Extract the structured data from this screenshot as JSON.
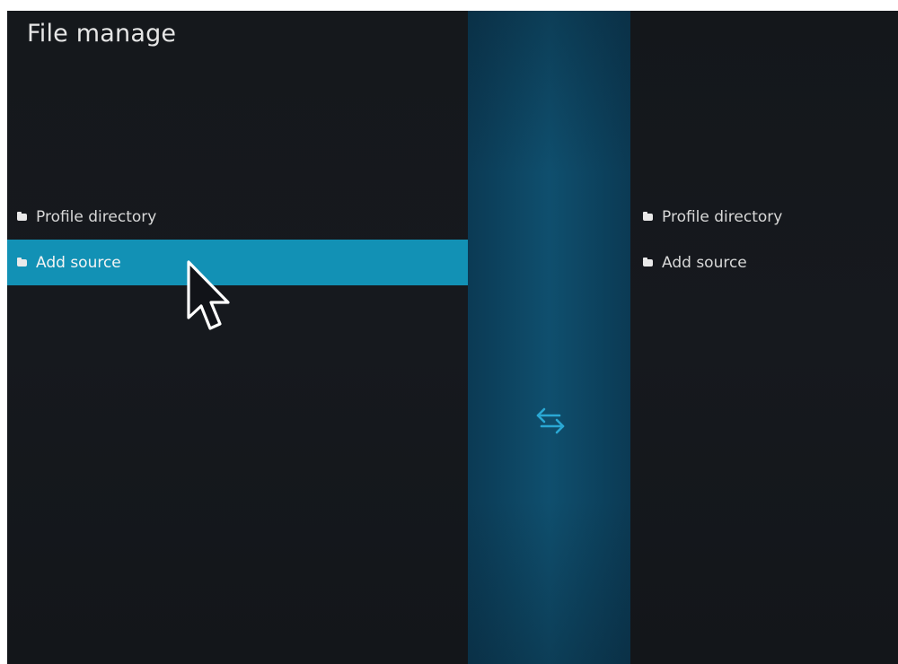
{
  "header": {
    "title": "File manage"
  },
  "left_pane": {
    "items": [
      {
        "label": "Profile directory",
        "icon": "folder-icon",
        "selected": false
      },
      {
        "label": "Add source",
        "icon": "folder-icon",
        "selected": true
      }
    ]
  },
  "right_pane": {
    "items": [
      {
        "label": "Profile directory",
        "icon": "folder-icon",
        "selected": false
      },
      {
        "label": "Add source",
        "icon": "folder-icon",
        "selected": false
      }
    ]
  },
  "divider": {
    "icon": "swap-arrows-icon"
  },
  "colors": {
    "background": "#15181d",
    "selection": "#1291b5",
    "divider": "#0f4f6e",
    "accent": "#2aa8d4",
    "text": "#d8d8d8"
  }
}
